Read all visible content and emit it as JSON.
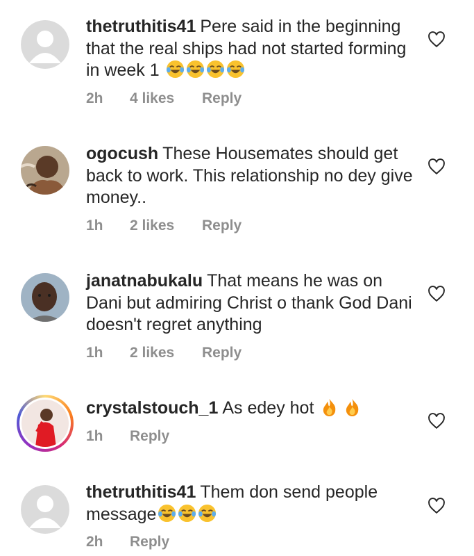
{
  "comments": [
    {
      "username": "thetruthitis41",
      "text": "Pere said in the beginning that the real ships had not started forming in week 1",
      "emojis": [
        "laughing-tears",
        "laughing-tears",
        "laughing-tears",
        "laughing-tears"
      ],
      "time": "2h",
      "likes": "4 likes",
      "reply": "Reply",
      "avatar": "default-avatar"
    },
    {
      "username": "ogocush",
      "text": "These Housemates should get back to work. This relationship no dey give money..",
      "emojis": [],
      "time": "1h",
      "likes": "2 likes",
      "reply": "Reply",
      "avatar": "photo-avatar"
    },
    {
      "username": "janatnabukalu",
      "text": "That means he was on Dani but admiring Christ o thank God Dani doesn't regret anything",
      "emojis": [],
      "time": "1h",
      "likes": "2 likes",
      "reply": "Reply",
      "avatar": "photo-avatar"
    },
    {
      "username": "crystalstouch_1",
      "text": "As edey hot",
      "emojis": [
        "fire",
        "fire"
      ],
      "time": "1h",
      "likes": "",
      "reply": "Reply",
      "avatar": "story-avatar"
    },
    {
      "username": "thetruthitis41",
      "text": "Them don send people message",
      "emojis": [
        "laughing-tears",
        "laughing-tears",
        "laughing-tears"
      ],
      "time": "2h",
      "likes": "",
      "reply": "Reply",
      "avatar": "default-avatar"
    }
  ],
  "icons": {
    "like": "heart-outline-icon"
  },
  "colors": {
    "meta_gray": "#8e8e8e",
    "text": "#262626",
    "emoji_yellow": "#f9c22e",
    "fire_orange": "#f4900c"
  }
}
